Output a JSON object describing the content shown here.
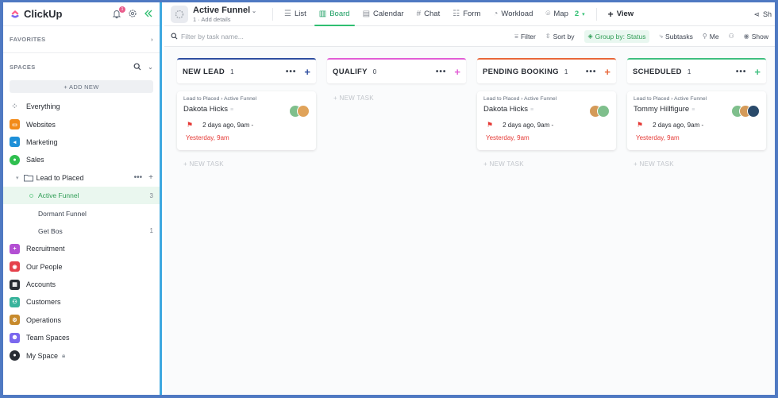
{
  "app": {
    "name": "ClickUp",
    "notification_badge": "1"
  },
  "sidebar": {
    "favorites_label": "FAVORITES",
    "spaces_label": "SPACES",
    "add_new_label": "+ ADD NEW",
    "items": [
      {
        "label": "Everything",
        "icon": "grid-icon",
        "color": "#b9bec7"
      },
      {
        "label": "Websites",
        "icon": "monitor-icon",
        "color": "#f28b1a"
      },
      {
        "label": "Marketing",
        "icon": "megaphone-icon",
        "color": "#1e90d8"
      },
      {
        "label": "Sales",
        "icon": "chat-icon",
        "color": "#2fbf4f"
      }
    ],
    "folder": {
      "label": "Lead to Placed"
    },
    "lists": [
      {
        "label": "Active Funnel",
        "count": "3"
      },
      {
        "label": "Dormant Funnel",
        "count": ""
      },
      {
        "label": "Get Bos",
        "count": "1"
      }
    ],
    "spaces": [
      {
        "label": "Recruitment",
        "icon": "user-add-icon",
        "color": "#b34fd3"
      },
      {
        "label": "Our People",
        "icon": "target-icon",
        "color": "#e5414b"
      },
      {
        "label": "Accounts",
        "icon": "calculator-icon",
        "color": "#292d34"
      },
      {
        "label": "Customers",
        "icon": "people-icon",
        "color": "#37b39b"
      },
      {
        "label": "Operations",
        "icon": "cogs-icon",
        "color": "#c78a2c"
      },
      {
        "label": "Team Spaces",
        "icon": "team-icon",
        "color": "#7b68ee"
      },
      {
        "label": "My Space",
        "icon": "avatar-icon",
        "color": "#292d34"
      }
    ]
  },
  "header": {
    "list_title": "Active Funnel",
    "subtitle": "1  ·  Add details",
    "tabs": [
      {
        "label": "List",
        "icon": "list-icon",
        "active": false
      },
      {
        "label": "Board",
        "icon": "board-icon",
        "active": true
      },
      {
        "label": "Calendar",
        "icon": "calendar-icon",
        "active": false
      },
      {
        "label": "Chat",
        "icon": "hash-icon",
        "active": false
      },
      {
        "label": "Form",
        "icon": "form-icon",
        "active": false
      },
      {
        "label": "Workload",
        "icon": "gauge-icon",
        "active": false
      },
      {
        "label": "Map",
        "icon": "map-pin-icon",
        "active": false
      }
    ],
    "map_count": "2",
    "add_view_label": "View",
    "share_label": "Sh"
  },
  "toolbar": {
    "search_placeholder": "Filter by task name...",
    "filter_label": "Filter",
    "sort_label": "Sort by",
    "group_label": "Group by: Status",
    "subtasks_label": "Subtasks",
    "me_label": "Me",
    "show_label": "Show"
  },
  "board": {
    "new_task_label": "+ NEW TASK",
    "columns": [
      {
        "name": "NEW LEAD",
        "count": "1",
        "color": "#2f4ea0",
        "cards": [
          {
            "crumb": "Lead to Placed  › Active Funnel",
            "name": "Dakota Hicks",
            "updated": "2 days ago, 9am  -",
            "due": "Yesterday, 9am"
          }
        ]
      },
      {
        "name": "QUALIFY",
        "count": "0",
        "color": "#e25dd5",
        "cards": []
      },
      {
        "name": "PENDING BOOKING",
        "count": "1",
        "color": "#e8673a",
        "cards": [
          {
            "crumb": "Lead to Placed  › Active Funnel",
            "name": "Dakota Hicks",
            "updated": "2 days ago, 9am  -",
            "due": "Yesterday, 9am"
          }
        ]
      },
      {
        "name": "SCHEDULED",
        "count": "1",
        "color": "#3fbf7f",
        "cards": [
          {
            "crumb": "Lead to Placed  › Active Funnel",
            "name": "Tommy Hillfigure",
            "updated": "2 days ago, 9am  -",
            "due": "Yesterday, 9am"
          }
        ]
      }
    ]
  }
}
